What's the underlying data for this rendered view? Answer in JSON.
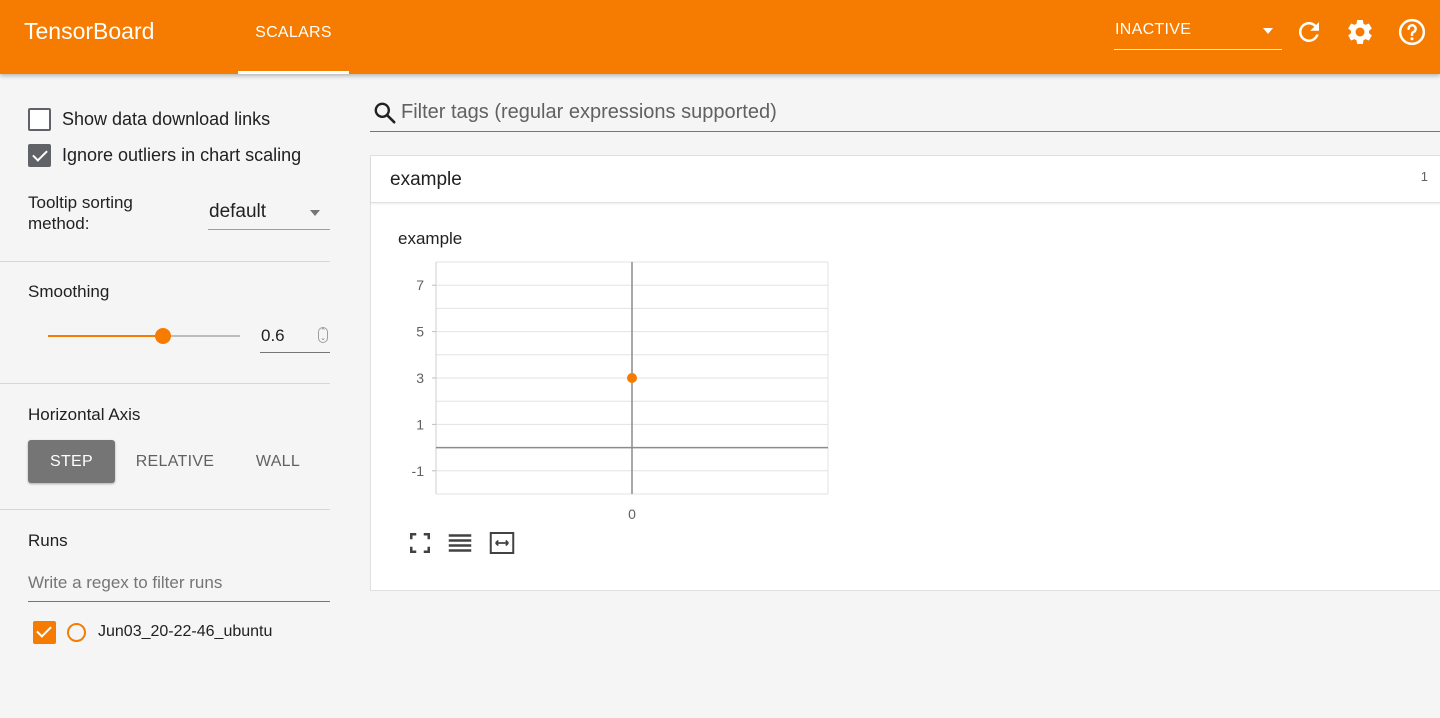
{
  "header": {
    "brand": "TensorBoard",
    "tabs": [
      {
        "label": "SCALARS",
        "active": true
      }
    ],
    "status_select": "INACTIVE",
    "icons": [
      "refresh-icon",
      "settings-icon",
      "help-icon"
    ],
    "accent_color": "#f57c00"
  },
  "sidebar": {
    "show_download_links": {
      "label": "Show data download links",
      "checked": false
    },
    "ignore_outliers": {
      "label": "Ignore outliers in chart scaling",
      "checked": true
    },
    "tooltip_sorting": {
      "label": "Tooltip sorting method:",
      "value": "default"
    },
    "smoothing": {
      "label": "Smoothing",
      "value": "0.6",
      "fraction": 0.6
    },
    "horizontal_axis": {
      "label": "Horizontal Axis",
      "options": [
        "STEP",
        "RELATIVE",
        "WALL"
      ],
      "selected": "STEP"
    },
    "runs": {
      "label": "Runs",
      "filter_placeholder": "Write a regex to filter runs",
      "items": [
        {
          "name": "Jun03_20-22-46_ubuntu",
          "checked": true,
          "color": "#f57c00"
        }
      ]
    }
  },
  "main": {
    "filter_placeholder": "Filter tags (regular expressions supported)",
    "category": {
      "title": "example",
      "count": "1"
    },
    "chart_title": "example",
    "chart_data": {
      "type": "scatter",
      "title": "example",
      "xlabel": "",
      "ylabel": "",
      "x_ticks": [
        "0"
      ],
      "y_ticks": [
        "7",
        "5",
        "3",
        "1",
        "-1"
      ],
      "xlim": [
        -1,
        1
      ],
      "ylim": [
        -2,
        8
      ],
      "grid": true,
      "series": [
        {
          "x": [
            0
          ],
          "y": [
            3
          ],
          "color": "#f57c00"
        }
      ]
    },
    "chart_tools": [
      "fullscreen-icon",
      "data-table-icon",
      "fit-domain-icon"
    ]
  }
}
